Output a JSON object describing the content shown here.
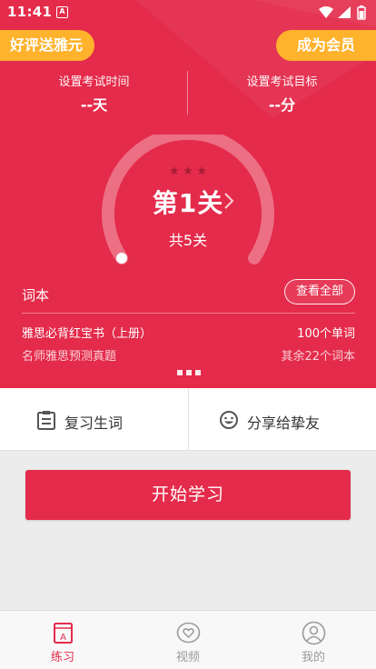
{
  "status_bar": {
    "time": "11:41",
    "app_badge": "A"
  },
  "promo": {
    "left_label": "好评送雅元",
    "right_label": "成为会员"
  },
  "exam": {
    "time_label": "设置考试时间",
    "time_value": "--天",
    "goal_label": "设置考试目标",
    "goal_value": "--分"
  },
  "level": {
    "title": "第1关",
    "total": "共5关",
    "stars_earned": 0,
    "stars_total": 3,
    "progress": 0
  },
  "wordbook": {
    "header": "词本",
    "view_all": "查看全部",
    "name": "雅思必背红宝书（上册）",
    "word_count": "100个单词",
    "subtitle": "名师雅思预测真题",
    "remaining": "其余22个词本",
    "pages": 3
  },
  "actions": {
    "review": "复习生词",
    "share": "分享给挚友"
  },
  "start_button": "开始学习",
  "tabs": [
    {
      "label": "练习",
      "icon": "practice-book-icon",
      "active": true
    },
    {
      "label": "视频",
      "icon": "video-heart-icon",
      "active": false
    },
    {
      "label": "我的",
      "icon": "profile-icon",
      "active": false
    }
  ],
  "colors": {
    "primary": "#e42b4b",
    "promo": "#ffb22c",
    "tab_inactive": "#9a9a9a"
  }
}
